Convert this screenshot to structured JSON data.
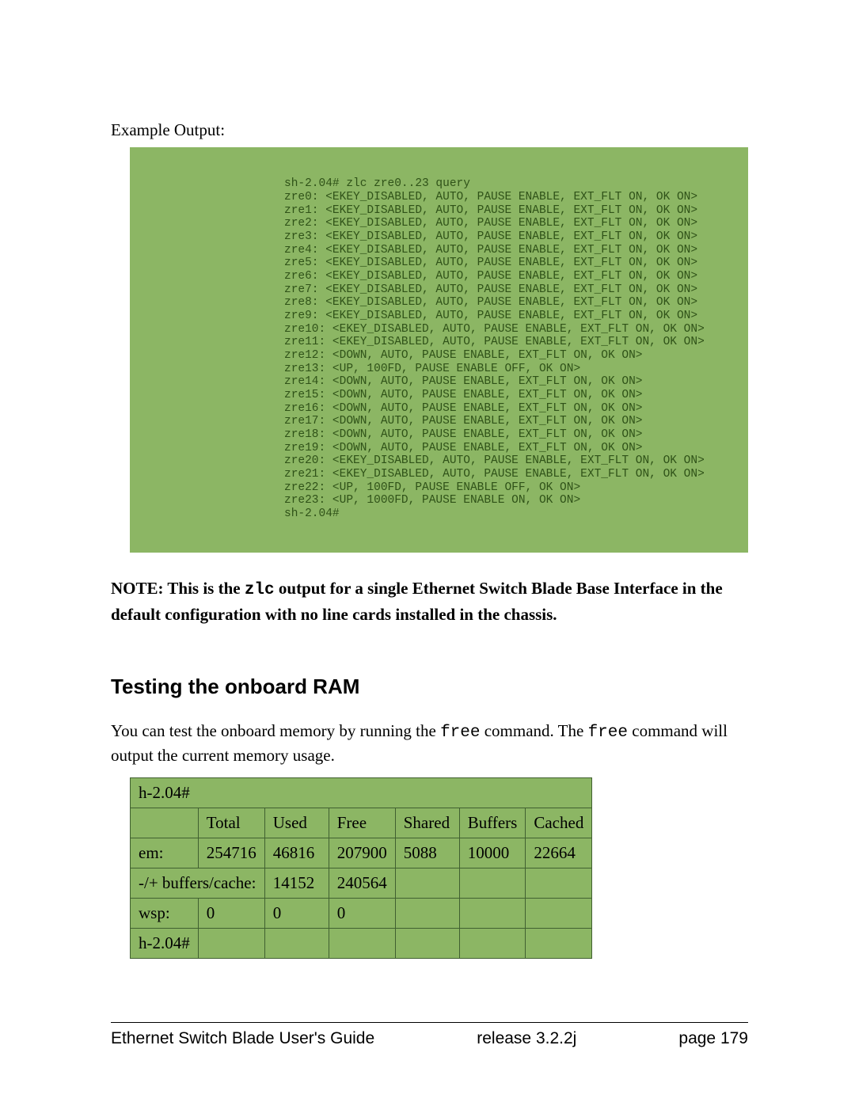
{
  "intro_label": "Example Output:",
  "code_lines": [
    "sh-2.04# zlc zre0..23 query",
    "zre0: <EKEY_DISABLED, AUTO, PAUSE ENABLE, EXT_FLT ON, OK ON>",
    "zre1: <EKEY_DISABLED, AUTO, PAUSE ENABLE, EXT_FLT ON, OK ON>",
    "zre2: <EKEY_DISABLED, AUTO, PAUSE ENABLE, EXT_FLT ON, OK ON>",
    "zre3: <EKEY_DISABLED, AUTO, PAUSE ENABLE, EXT_FLT ON, OK ON>",
    "zre4: <EKEY_DISABLED, AUTO, PAUSE ENABLE, EXT_FLT ON, OK ON>",
    "zre5: <EKEY_DISABLED, AUTO, PAUSE ENABLE, EXT_FLT ON, OK ON>",
    "zre6: <EKEY_DISABLED, AUTO, PAUSE ENABLE, EXT_FLT ON, OK ON>",
    "zre7: <EKEY_DISABLED, AUTO, PAUSE ENABLE, EXT_FLT ON, OK ON>",
    "zre8: <EKEY_DISABLED, AUTO, PAUSE ENABLE, EXT_FLT ON, OK ON>",
    "zre9: <EKEY_DISABLED, AUTO, PAUSE ENABLE, EXT_FLT ON, OK ON>",
    "zre10: <EKEY_DISABLED, AUTO, PAUSE ENABLE, EXT_FLT ON, OK ON>",
    "zre11: <EKEY_DISABLED, AUTO, PAUSE ENABLE, EXT_FLT ON, OK ON>",
    "zre12: <DOWN, AUTO, PAUSE ENABLE, EXT_FLT ON, OK ON>",
    "zre13: <UP, 100FD, PAUSE ENABLE OFF, OK ON>",
    "zre14: <DOWN, AUTO, PAUSE ENABLE, EXT_FLT ON, OK ON>",
    "zre15: <DOWN, AUTO, PAUSE ENABLE, EXT_FLT ON, OK ON>",
    "zre16: <DOWN, AUTO, PAUSE ENABLE, EXT_FLT ON, OK ON>",
    "zre17: <DOWN, AUTO, PAUSE ENABLE, EXT_FLT ON, OK ON>",
    "zre18: <DOWN, AUTO, PAUSE ENABLE, EXT_FLT ON, OK ON>",
    "zre19: <DOWN, AUTO, PAUSE ENABLE, EXT_FLT ON, OK ON>",
    "zre20: <EKEY_DISABLED, AUTO, PAUSE ENABLE, EXT_FLT ON, OK ON>",
    "zre21: <EKEY_DISABLED, AUTO, PAUSE ENABLE, EXT_FLT ON, OK ON>",
    "zre22: <UP, 100FD, PAUSE ENABLE OFF, OK ON>",
    "zre23: <UP, 1000FD, PAUSE ENABLE ON, OK ON>",
    "sh-2.04#"
  ],
  "note": {
    "prefix": "NOTE: This is the ",
    "code": "zlc",
    "suffix": " output for a single Ethernet Switch Blade Base Interface in the default configuration with no line cards installed in the chassis."
  },
  "section_heading": "Testing the onboard RAM",
  "body": {
    "p1a": "You can test the onboard memory by running the ",
    "p1_code1": "free",
    "p1b": " command. The ",
    "p1_code2": "free",
    "p1c": " command will output the current memory usage."
  },
  "mem_table": {
    "row0": {
      "c0": "h-2.04#"
    },
    "header": {
      "c0": "",
      "c1": "Total",
      "c2": "Used",
      "c3": "Free",
      "c4": "Shared",
      "c5": "Buffers",
      "c6": "Cached"
    },
    "row_em": {
      "c0": "em:",
      "c1": "254716",
      "c2": "46816",
      "c3": "207900",
      "c4": "5088",
      "c5": "10000",
      "c6": "22664"
    },
    "row_bc": {
      "c0": "-/+ buffers/cache:",
      "c2": "14152",
      "c3": "240564"
    },
    "row_wsp": {
      "c0": "wsp:",
      "c1": "0",
      "c2": "0",
      "c3": "0"
    },
    "row_last": {
      "c0": "h-2.04#"
    }
  },
  "footer": {
    "left": "Ethernet Switch Blade User's Guide",
    "mid": "release  3.2.2j",
    "right": "page 179"
  }
}
